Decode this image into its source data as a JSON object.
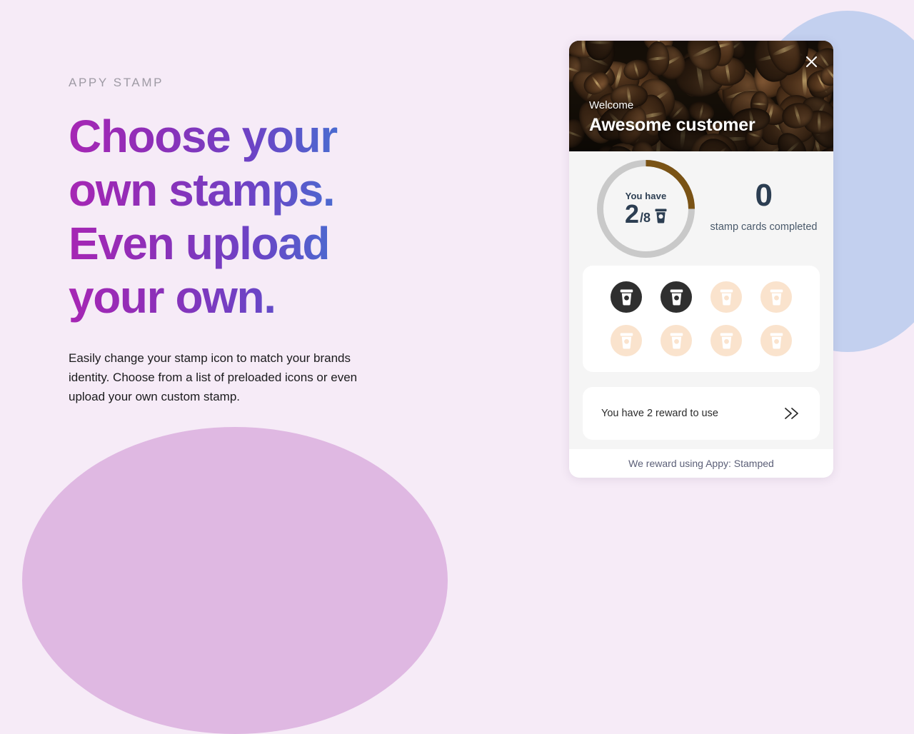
{
  "theme": {
    "page_background": "#F6EBF7",
    "blob_blue": "#C3D0EF",
    "blob_purple": "#DFB8E2",
    "headline_gradient_start": "#A626B4",
    "headline_gradient_end": "#3B7ED6",
    "ring_progress_color": "#7A5315",
    "ring_track_color": "#C9C9C9",
    "stamp_filled_color": "#2F2F2F",
    "stamp_empty_color": "#FAE3CD",
    "navy_text": "#2C3E52"
  },
  "left": {
    "eyebrow": "APPY STAMP",
    "headline": "Choose your own stamps. Even upload your own.",
    "body": "Easily change your stamp icon to match your brands identity. Choose from a list of preloaded icons or even upload your own custom stamp."
  },
  "widget": {
    "hero": {
      "welcome_label": "Welcome",
      "customer_name": "Awesome customer",
      "close_icon": "close-icon",
      "background_image": "coffee-beans-photo"
    },
    "progress": {
      "you_have_label": "You have",
      "stamps_collected": "2",
      "stamps_total": "/8",
      "stamps_collected_value": 2,
      "stamps_total_value": 8,
      "progress_percent": 25,
      "ring_icon": "coffee-cup-icon"
    },
    "completed": {
      "count": "0",
      "label": "stamp cards completed"
    },
    "stamp_grid": {
      "icon": "coffee-cup-icon",
      "slots": [
        {
          "state": "filled"
        },
        {
          "state": "filled"
        },
        {
          "state": "empty"
        },
        {
          "state": "empty"
        },
        {
          "state": "empty"
        },
        {
          "state": "empty"
        },
        {
          "state": "empty"
        },
        {
          "state": "empty"
        }
      ]
    },
    "reward": {
      "text": "You have 2 reward to use",
      "chevron_icon": "double-chevron-right-icon"
    },
    "footer": {
      "text": "We reward using Appy: Stamped"
    }
  }
}
